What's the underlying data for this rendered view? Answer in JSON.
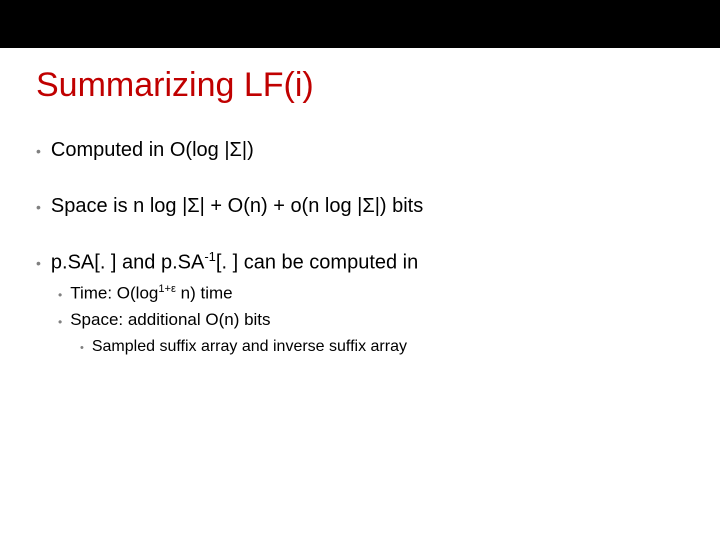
{
  "title": "Summarizing LF(i)",
  "bullets": {
    "b1a": "Computed in O(log |Σ|)",
    "b1b": "Space is n log |Σ| + O(n) + o(n log |Σ|) bits",
    "b1c_pre": "p.SA[. ] and p.SA",
    "b1c_sup": "-1",
    "b1c_post": "[. ] can be computed in",
    "b2a_pre": "Time: O(log",
    "b2a_sup": "1+ε",
    "b2a_post": " n) time",
    "b2b": "Space: additional O(n) bits",
    "b3a": "Sampled suffix array and inverse suffix array"
  }
}
